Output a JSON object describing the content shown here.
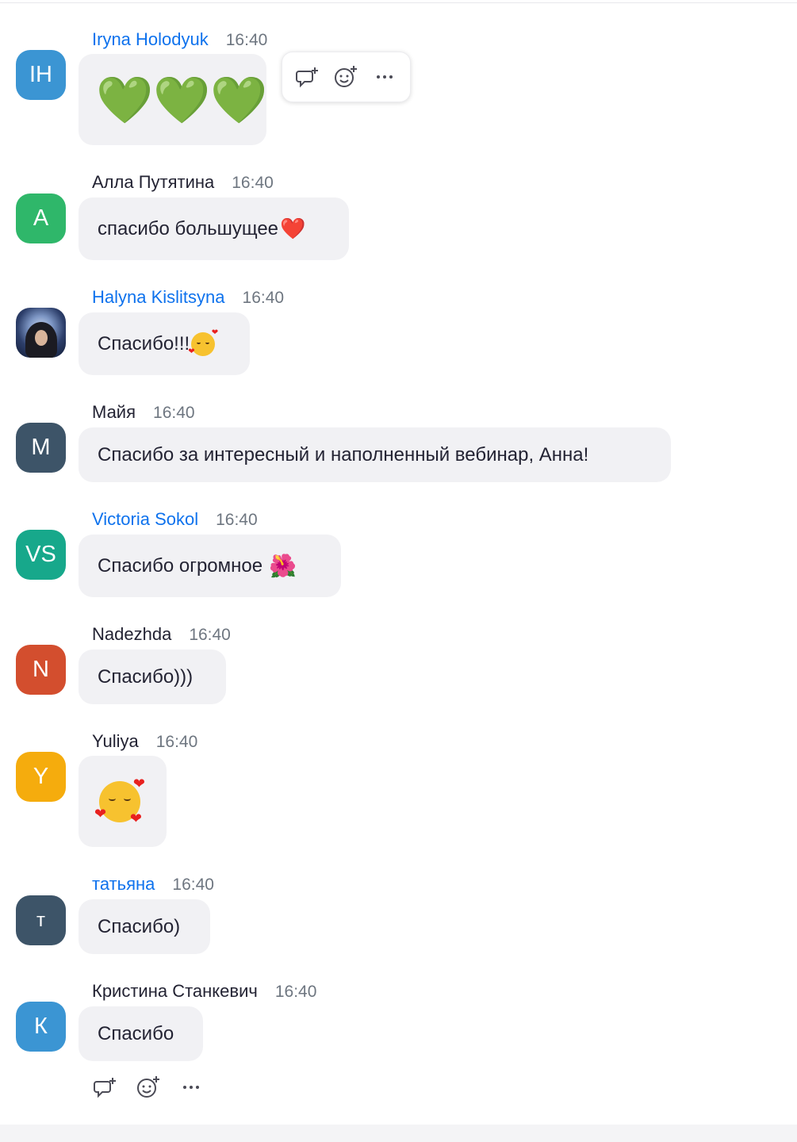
{
  "messages": [
    {
      "avatar": {
        "initials": "IH",
        "color": "#3b95d3"
      },
      "name": "Iryna Holodyuk",
      "name_color": "#0e72ed",
      "time": "16:40",
      "text": "",
      "emoji": "💚💚💚"
    },
    {
      "avatar": {
        "initials": "А",
        "color": "#2fb76a"
      },
      "name": "Алла Путятина",
      "name_color": "#232333",
      "time": "16:40",
      "text": "спасибо большущее",
      "emoji": "❤️"
    },
    {
      "avatar": {
        "initials": "",
        "color": "#22375e"
      },
      "name": "Halyna Kislitsyna",
      "name_color": "#0e72ed",
      "time": "16:40",
      "text": "Спасибо!!!",
      "emoji": "🥰"
    },
    {
      "avatar": {
        "initials": "М",
        "color": "#3d5468"
      },
      "name": "Майя",
      "name_color": "#232333",
      "time": "16:40",
      "text": "Спасибо за интересный и наполненный вебинар, Анна!",
      "emoji": ""
    },
    {
      "avatar": {
        "initials": "VS",
        "color": "#17a88b"
      },
      "name": "Victoria Sokol",
      "name_color": "#0e72ed",
      "time": "16:40",
      "text": "Спасибо огромное",
      "emoji": "🌺"
    },
    {
      "avatar": {
        "initials": "N",
        "color": "#d34e2e"
      },
      "name": "Nadezhda",
      "name_color": "#232333",
      "time": "16:40",
      "text": "Спасибо)))",
      "emoji": ""
    },
    {
      "avatar": {
        "initials": "Y",
        "color": "#f5ac0d"
      },
      "name": "Yuliya",
      "name_color": "#232333",
      "time": "16:40",
      "text": "",
      "emoji": "🥰"
    },
    {
      "avatar": {
        "initials": "т",
        "color": "#3d5468"
      },
      "name": "татьяна",
      "name_color": "#0e72ed",
      "time": "16:40",
      "text": "Спасибо)",
      "emoji": ""
    },
    {
      "avatar": {
        "initials": "К",
        "color": "#3b95d3"
      },
      "name": "Кристина Станкевич",
      "name_color": "#232333",
      "time": "16:40",
      "text": "Спасибо",
      "emoji": ""
    }
  ],
  "actions": {
    "reply_icon": "reply-thread-icon",
    "reaction_icon": "add-reaction-icon",
    "more_icon": "more-options-icon",
    "more_label": "···"
  }
}
